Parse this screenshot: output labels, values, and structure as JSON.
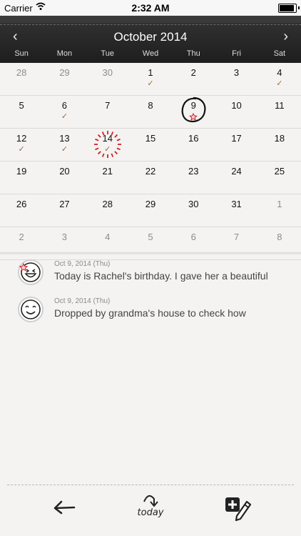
{
  "status_bar": {
    "carrier": "Carrier",
    "time": "2:32 AM"
  },
  "header": {
    "month_title": "October 2014",
    "prev": "‹",
    "next": "›",
    "weekdays": [
      "Sun",
      "Mon",
      "Tue",
      "Wed",
      "Thu",
      "Fri",
      "Sat"
    ]
  },
  "calendar": {
    "weeks": [
      [
        {
          "d": "28",
          "other": true
        },
        {
          "d": "29",
          "other": true
        },
        {
          "d": "30",
          "other": true
        },
        {
          "d": "1",
          "check": true
        },
        {
          "d": "2"
        },
        {
          "d": "3"
        },
        {
          "d": "4",
          "check": true
        }
      ],
      [
        {
          "d": "5"
        },
        {
          "d": "6",
          "check": true
        },
        {
          "d": "7"
        },
        {
          "d": "8"
        },
        {
          "d": "9",
          "selected": true,
          "star": true
        },
        {
          "d": "10"
        },
        {
          "d": "11"
        }
      ],
      [
        {
          "d": "12",
          "check": true
        },
        {
          "d": "13",
          "check": true
        },
        {
          "d": "14",
          "today": true,
          "check": true
        },
        {
          "d": "15"
        },
        {
          "d": "16"
        },
        {
          "d": "17"
        },
        {
          "d": "18"
        }
      ],
      [
        {
          "d": "19"
        },
        {
          "d": "20"
        },
        {
          "d": "21"
        },
        {
          "d": "22"
        },
        {
          "d": "23"
        },
        {
          "d": "24"
        },
        {
          "d": "25"
        }
      ],
      [
        {
          "d": "26"
        },
        {
          "d": "27"
        },
        {
          "d": "28"
        },
        {
          "d": "29"
        },
        {
          "d": "30"
        },
        {
          "d": "31"
        },
        {
          "d": "1",
          "other": true
        }
      ],
      [
        {
          "d": "2",
          "other": true
        },
        {
          "d": "3",
          "other": true
        },
        {
          "d": "4",
          "other": true
        },
        {
          "d": "5",
          "other": true
        },
        {
          "d": "6",
          "other": true
        },
        {
          "d": "7",
          "other": true
        },
        {
          "d": "8",
          "other": true
        }
      ]
    ]
  },
  "entries": [
    {
      "date": "Oct 9, 2014 (Thu)",
      "text": "Today is Rachel's birthday. I gave her a beautiful"
    },
    {
      "date": "Oct 9, 2014 (Thu)",
      "text": "Dropped by grandma's house to check how"
    }
  ],
  "toolbar": {
    "today_label": "today",
    "back_icon": "back-arrow-icon",
    "add_icon": "add-entry-pencil-icon"
  },
  "colors": {
    "header_bg": "#262626",
    "check": "#9a6a3e",
    "today_burst": "#d01f2b",
    "star": "#d01f2b"
  }
}
